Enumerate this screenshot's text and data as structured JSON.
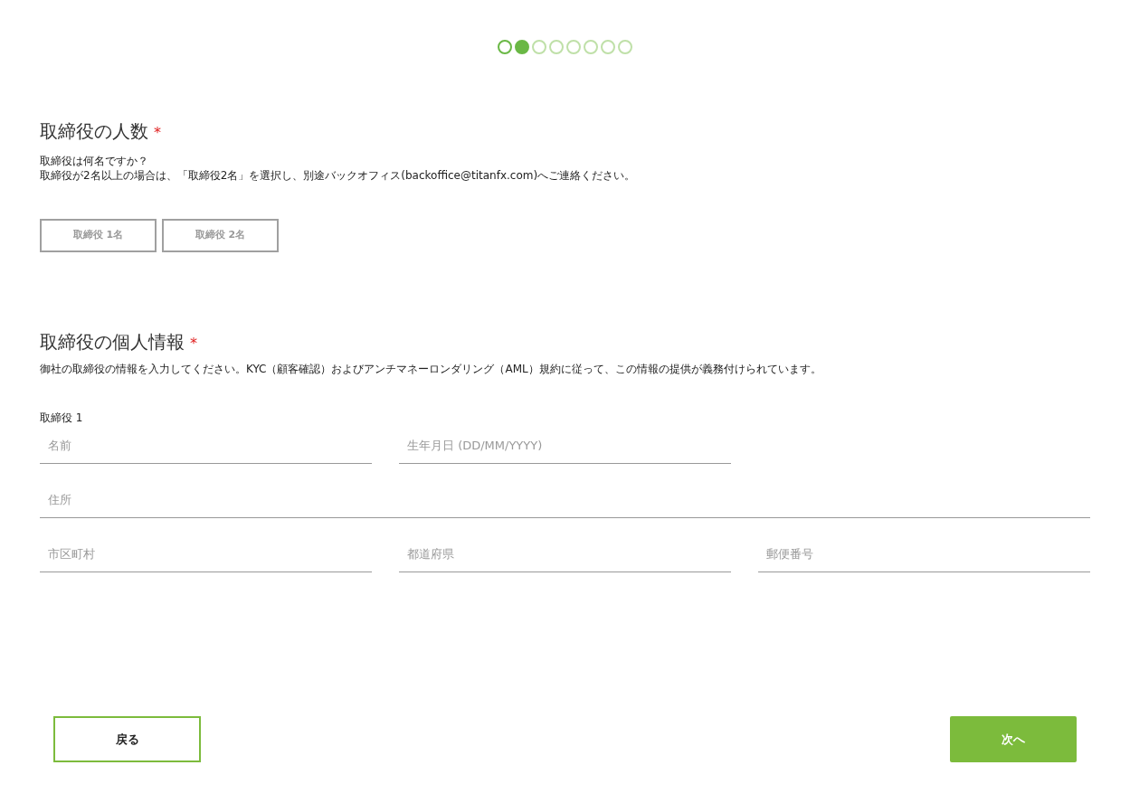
{
  "stepper": [
    {
      "completed": true,
      "selected": false
    },
    {
      "completed": false,
      "selected": true
    },
    {
      "completed": false,
      "selected": false
    },
    {
      "completed": false,
      "selected": false
    },
    {
      "completed": false,
      "selected": false
    },
    {
      "completed": false,
      "selected": false
    },
    {
      "completed": false,
      "selected": false
    },
    {
      "completed": false,
      "selected": false
    }
  ],
  "director_count": {
    "title": "取締役の人数",
    "required": true,
    "required_mark": "*",
    "description": [
      "取締役は何名ですか？",
      "取締役が2名以上の場合は、「取締役2名」を選択し、別途バックオフィス(backoffice@titanfx.com)へご連絡ください。"
    ],
    "options": [
      {
        "label": "取締役 1名",
        "selected": false
      },
      {
        "label": "取締役 2名",
        "selected": false
      }
    ]
  },
  "director_info": {
    "title": "取締役の個人情報",
    "required": true,
    "required_mark": "*",
    "description": "御社の取締役の情報を入力してください。KYC（顧客確認）およびアンチマネーロンダリング（AML）規約に従って、この情報の提供が義務付けられています。",
    "subtitle": "取締役 1",
    "rows": [
      [
        {
          "placeholder": "名前"
        },
        {
          "placeholder": "生年月日 (DD/MM/YYYY)"
        }
      ],
      [
        {
          "placeholder": "住所",
          "wide": true
        }
      ],
      [
        {
          "placeholder": "市区町村"
        },
        {
          "placeholder": "都道府県"
        },
        {
          "placeholder": "郵便番号"
        }
      ]
    ]
  },
  "back_button": "戻る",
  "next_button": "次へ"
}
